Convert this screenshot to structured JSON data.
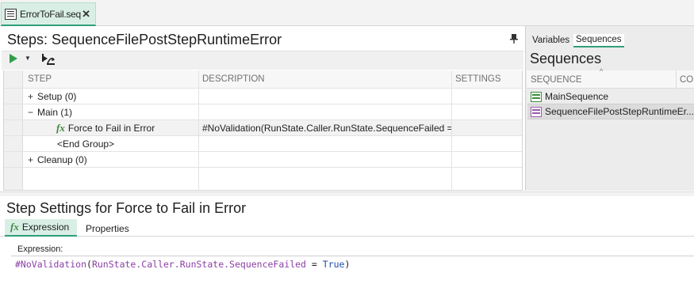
{
  "document_tab": {
    "label": "ErrorToFail.seq",
    "close": "✕"
  },
  "steps_panel": {
    "title": "Steps: SequenceFilePostStepRuntimeError",
    "pin": "📌",
    "columns": {
      "step": "STEP",
      "description": "DESCRIPTION",
      "settings": "SETTINGS"
    },
    "rows": [
      {
        "expander": "+",
        "step": "Setup (0)",
        "description": "",
        "settings": ""
      },
      {
        "expander": "−",
        "step": "Main (1)",
        "description": "",
        "settings": ""
      },
      {
        "icon": "fx-expression-icon",
        "step": "Force to Fail in Error",
        "description": "#NoValidation(RunState.Caller.RunState.SequenceFailed = True)",
        "settings": "",
        "selected": true
      },
      {
        "step": "<End Group>",
        "description": "",
        "settings": ""
      },
      {
        "expander": "+",
        "step": "Cleanup (0)",
        "description": "",
        "settings": ""
      }
    ]
  },
  "right_pane": {
    "tabs": {
      "variables": "Variables",
      "sequences": "Sequences"
    },
    "title": "Sequences",
    "columns": {
      "sequence": "SEQUENCE",
      "comment": "CO"
    },
    "sort_indicator": "^",
    "items": [
      {
        "name": "MainSequence",
        "color": "#3d8f3d"
      },
      {
        "name": "SequenceFilePostStepRuntimeEr...",
        "color": "#9a5cae",
        "selected": true
      }
    ]
  },
  "step_settings": {
    "title": "Step Settings for Force to Fail in Error",
    "tabs": {
      "expression": "Expression",
      "properties": "Properties",
      "expression_icon": "fx"
    },
    "expression_label": "Expression:",
    "expression": {
      "prefix": "#NoValidation",
      "open": "(",
      "object": "RunState.Caller.RunState.SequenceFailed",
      "operator": " = ",
      "value": "True",
      "close": ")"
    }
  },
  "colors": {
    "accent": "#2f9e7a",
    "run_green": "#2f9e48",
    "tab_active_bg": "#d9efe6"
  }
}
